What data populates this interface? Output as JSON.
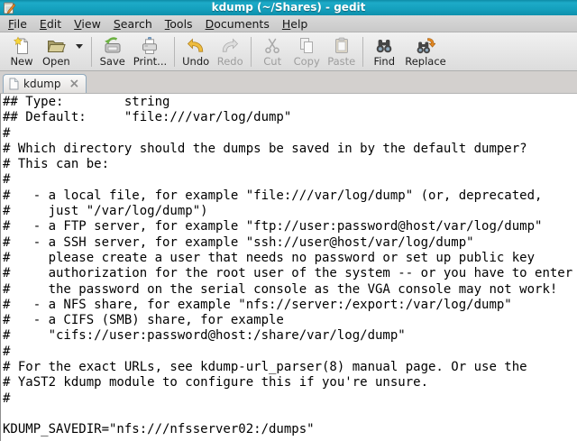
{
  "window": {
    "title": "kdump (~/Shares) - gedit"
  },
  "menubar": {
    "items": [
      {
        "key": "F",
        "rest": "ile"
      },
      {
        "key": "E",
        "rest": "dit"
      },
      {
        "key": "V",
        "rest": "iew"
      },
      {
        "key": "S",
        "rest": "earch"
      },
      {
        "key": "T",
        "rest": "ools"
      },
      {
        "key": "D",
        "rest": "ocuments"
      },
      {
        "key": "H",
        "rest": "elp"
      }
    ]
  },
  "toolbar": {
    "buttons": [
      {
        "label": "New",
        "enabled": true
      },
      {
        "label": "Open",
        "enabled": true
      },
      {
        "label": "Save",
        "enabled": true
      },
      {
        "label": "Print...",
        "enabled": true
      },
      {
        "label": "Undo",
        "enabled": true
      },
      {
        "label": "Redo",
        "enabled": false
      },
      {
        "label": "Cut",
        "enabled": false
      },
      {
        "label": "Copy",
        "enabled": false
      },
      {
        "label": "Paste",
        "enabled": false
      },
      {
        "label": "Find",
        "enabled": true
      },
      {
        "label": "Replace",
        "enabled": true
      }
    ]
  },
  "tabbar": {
    "tabs": [
      {
        "label": "kdump",
        "close_glyph": "×"
      }
    ]
  },
  "editor": {
    "lines": [
      "## Type:        string",
      "## Default:     \"file:///var/log/dump\"",
      "#",
      "# Which directory should the dumps be saved in by the default dumper?",
      "# This can be:",
      "#",
      "#   - a local file, for example \"file:///var/log/dump\" (or, deprecated,",
      "#     just \"/var/log/dump\")",
      "#   - a FTP server, for example \"ftp://user:password@host/var/log/dump\"",
      "#   - a SSH server, for example \"ssh://user@host/var/log/dump\"",
      "#     please create a user that needs no password or set up public key",
      "#     authorization for the root user of the system -- or you have to enter",
      "#     the password on the serial console as the VGA console may not work!",
      "#   - a NFS share, for example \"nfs://server:/export:/var/log/dump\"",
      "#   - a CIFS (SMB) share, for example",
      "#     \"cifs://user:password@host:/share/var/log/dump\"",
      "#",
      "# For the exact URLs, see kdump-url_parser(8) manual page. Or use the",
      "# YaST2 kdump module to configure this if you're unsure.",
      "#",
      "",
      "KDUMP_SAVEDIR=\"nfs:///nfsserver02:/dumps\""
    ]
  },
  "colors": {
    "titlebar": "#14A0BD",
    "tab_border": "#8FA8BC",
    "undo_arrow": "#EEBC3E",
    "replace_arrow": "#E2861F",
    "save_arrow": "#6CB143",
    "new_star": "#F6D63C",
    "disabled_text": "#9D9D9D"
  }
}
